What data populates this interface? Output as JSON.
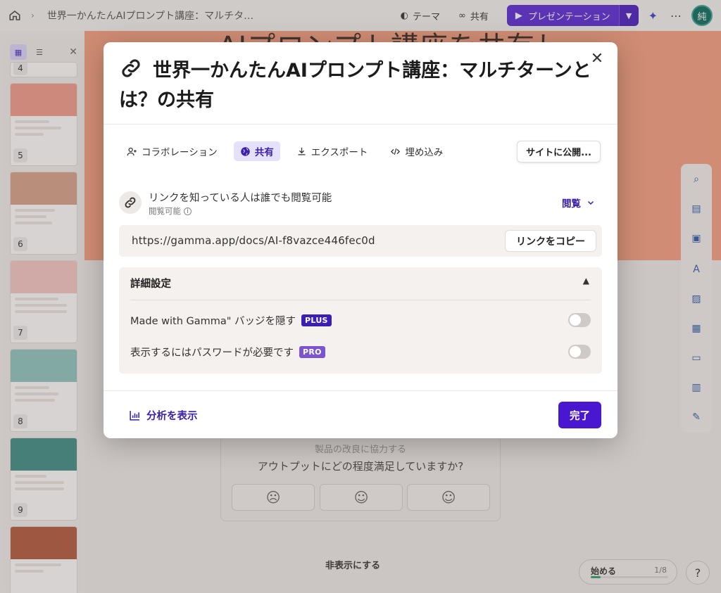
{
  "topbar": {
    "breadcrumb": "世界一かんたんAIプロンプト講座：マルチタ…",
    "theme_label": "テーマ",
    "share_label": "共有",
    "present_label": "プレゼンテーション",
    "avatar_initial": "純"
  },
  "slide": {
    "title_peek": "AIプロンプト講座を共有し"
  },
  "sidebar": {
    "slide_numbers": [
      "4",
      "5",
      "6",
      "7",
      "8",
      "9"
    ]
  },
  "feedback": {
    "subtitle": "製品の改良に協力する",
    "question": "アウトプットにどの程度満足していますか?"
  },
  "hide_label": "非表示にする",
  "progress": {
    "label": "始める",
    "count": "1/8",
    "fraction": 0.125
  },
  "help_label": "?",
  "modal": {
    "title": "世界一かんたんAIプロンプト講座：マルチターンとは？の共有",
    "tabs": [
      {
        "label": "コラボレーション",
        "active": false
      },
      {
        "label": "共有",
        "active": true
      },
      {
        "label": "エクスポート",
        "active": false
      },
      {
        "label": "埋め込み",
        "active": false
      }
    ],
    "publish_label": "サイトに公開...",
    "access": {
      "main": "リンクを知っている人は誰でも閲覧可能",
      "sub": "閲覧可能",
      "permission": "閲覧"
    },
    "link": {
      "url": "https://gamma.app/docs/AI-f8vazce446fec0d",
      "copy_label": "リンクをコピー"
    },
    "advanced": {
      "title": "詳細設定",
      "rows": [
        {
          "label": "Made with Gamma\" バッジを隠す",
          "badge": "PLUS",
          "badge_color": "#3b1fb5",
          "enabled": false
        },
        {
          "label": "表示するにはパスワードが必要です",
          "badge": "PRO",
          "badge_color": "#7a55cf",
          "enabled": false
        }
      ]
    },
    "analytics_label": "分析を表示",
    "done_label": "完了"
  },
  "colors": {
    "accent": "#4a17d0",
    "slide_bg": "#f7a182",
    "present_bg": "#5b2bd9"
  }
}
